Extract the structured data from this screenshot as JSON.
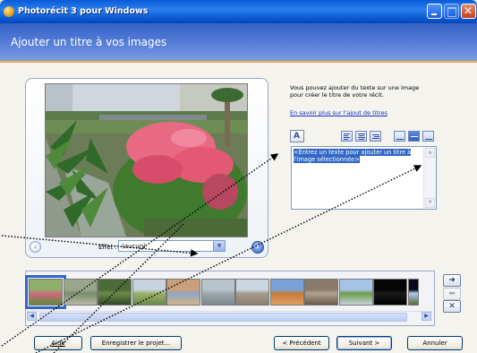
{
  "window": {
    "title": "Photorécit 3 pour Windows",
    "minimize_icon": "minimize-icon",
    "maximize_icon": "maximize-icon",
    "close_icon": "close-icon"
  },
  "header": {
    "title": "Ajouter un titre à vos images"
  },
  "preview": {
    "effect_label": "Effet :",
    "effect_value": "(aucun)",
    "prev_icon": "chevron-left-icon",
    "next_icon": "chevron-right-icon"
  },
  "info": {
    "text": "Vous pouvez ajouter du texte sur une image\npour créer le titre de votre récit.",
    "link": "En savoir plus sur l'ajout de titres"
  },
  "toolbar": {
    "font_icon": "font-icon",
    "buttons": [
      "align-top-left-icon",
      "align-top-center-icon",
      "align-top-right-icon",
      "align-middle-left-icon",
      "align-middle-center-icon",
      "align-middle-right-icon"
    ],
    "selected_index": 4
  },
  "textbox": {
    "placeholder_text": "<Entrez un texte pour ajouter un titre à l'image sélectionnée>"
  },
  "filmstrip": {
    "thumb_count": 12,
    "selected_index": 0,
    "right_icon": "arrow-right-icon",
    "left_icon": "arrow-left-icon",
    "remove_icon": "remove-icon"
  },
  "footer": {
    "help": "Aide",
    "save_project": "Enregistrer le projet...",
    "previous": "< Précédent",
    "next": "Suivant >",
    "cancel": "Annuler"
  },
  "colors": {
    "titlebar": "#0a5ad8",
    "header": "#4f74d2",
    "selection": "#3167c6",
    "accent_line": "#f0b050"
  }
}
